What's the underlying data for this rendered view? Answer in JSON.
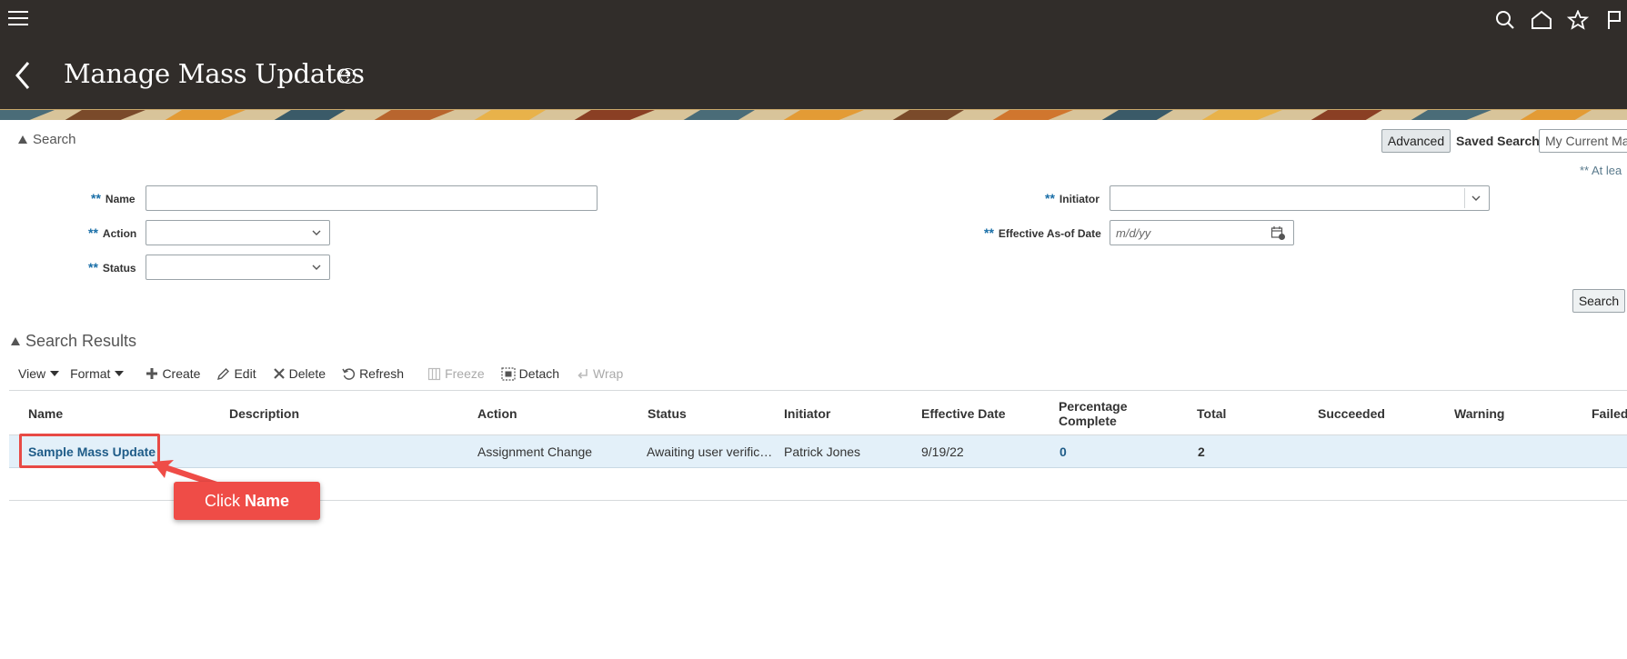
{
  "header": {
    "title": "Manage Mass Updates",
    "help": "?",
    "icons": [
      "hamburger-icon",
      "search-icon",
      "home-icon",
      "star-icon",
      "flag-icon",
      "back-chevron-icon",
      "help-icon"
    ]
  },
  "search": {
    "section_label": "Search",
    "advanced_label": "Advanced",
    "saved_search_label": "Saved Search",
    "saved_search_value": "My Current Ma",
    "at_least_note": "** At lea",
    "required_marker": "**",
    "fields": {
      "name_label": "Name",
      "name_value": "",
      "action_label": "Action",
      "action_value": "",
      "status_label": "Status",
      "status_value": "",
      "initiator_label": "Initiator",
      "initiator_value": "",
      "effective_label": "Effective As-of Date",
      "effective_placeholder": "m/d/yy"
    },
    "search_button": "Search"
  },
  "results": {
    "section_label": "Search Results",
    "toolbar": {
      "view": "View",
      "format": "Format",
      "create": "Create",
      "edit": "Edit",
      "delete": "Delete",
      "refresh": "Refresh",
      "freeze": "Freeze",
      "detach": "Detach",
      "wrap": "Wrap"
    },
    "columns": {
      "name": "Name",
      "description": "Description",
      "action": "Action",
      "status": "Status",
      "initiator": "Initiator",
      "effective_date": "Effective Date",
      "percentage_complete_1": "Percentage",
      "percentage_complete_2": "Complete",
      "total": "Total",
      "succeeded": "Succeeded",
      "warning": "Warning",
      "failed": "Failed"
    },
    "rows": [
      {
        "name": "Sample Mass Update",
        "description": "",
        "action": "Assignment Change",
        "status": "Awaiting user verific…",
        "initiator": "Patrick Jones",
        "effective_date": "9/19/22",
        "percentage_complete": "0",
        "total": "2",
        "succeeded": "",
        "warning": "",
        "failed": ""
      }
    ]
  },
  "annotation": {
    "callout_prefix": "Click",
    "callout_target": "Name",
    "color": "#ef4c47"
  },
  "colors": {
    "header_bg": "#312d2a",
    "link": "#1f5c88",
    "selected_row": "#e3f0f9"
  }
}
